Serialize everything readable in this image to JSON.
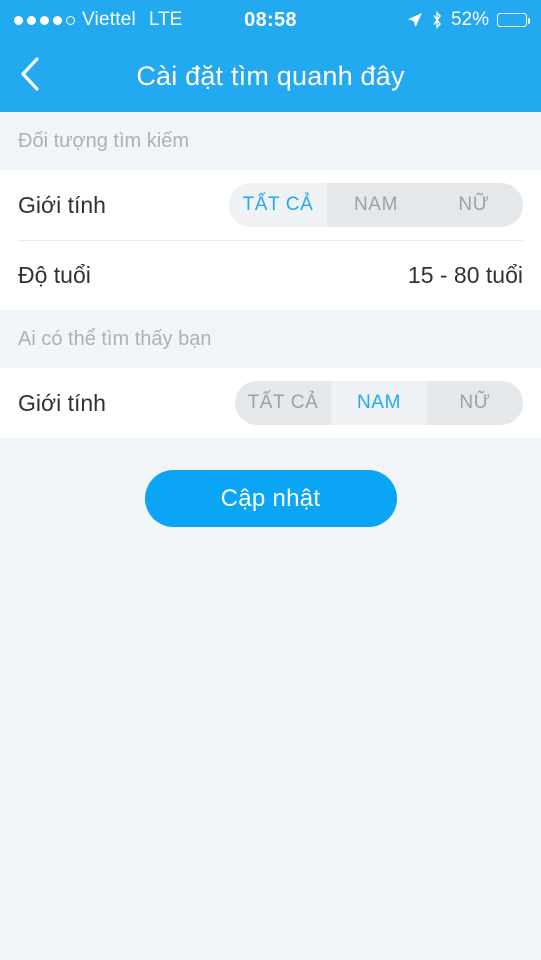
{
  "status_bar": {
    "carrier": "Viettel",
    "network": "LTE",
    "time": "08:58",
    "battery_text": "52%",
    "battery_level": 52,
    "signal_dots_filled": 4,
    "signal_dots_total": 5
  },
  "nav": {
    "title": "Cài đặt tìm quanh đây",
    "back_icon": "chevron-left-icon"
  },
  "sections": [
    {
      "header": "Đối tượng tìm kiếm",
      "rows": [
        {
          "label": "Giới tính",
          "type": "segmented",
          "options": [
            "TẤT CẢ",
            "NAM",
            "NỮ"
          ],
          "selected": 0
        },
        {
          "label": "Độ tuổi",
          "type": "value",
          "value": "15 - 80 tuổi"
        }
      ]
    },
    {
      "header": "Ai có thể tìm thấy bạn",
      "rows": [
        {
          "label": "Giới tính",
          "type": "segmented",
          "options": [
            "TẤT CẢ",
            "NAM",
            "NỮ"
          ],
          "selected": 1
        }
      ]
    }
  ],
  "footer": {
    "update_label": "Cập nhật"
  },
  "colors": {
    "accent": "#23a9ef",
    "button": "#0aa5f5",
    "page_bg": "#f2f5f7",
    "row_bg": "#ffffff",
    "segment_bg": "#e4e8ea",
    "segment_selected_bg": "#eef2f4",
    "muted_text": "#a8b2b8"
  }
}
